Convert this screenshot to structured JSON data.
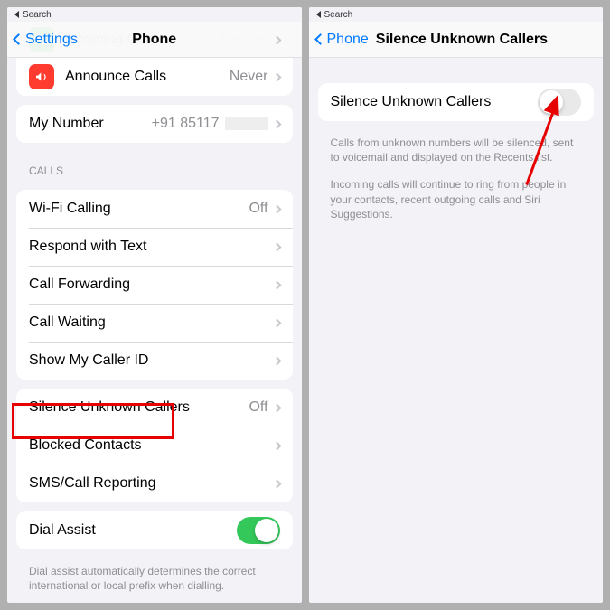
{
  "status": {
    "search_label": "Search"
  },
  "left": {
    "back_label": "Settings",
    "title": "Phone",
    "partial_rows": {
      "incoming_label": "incoming Calls",
      "incoming_value": "Banner"
    },
    "announce": {
      "label": "Announce Calls",
      "value": "Never"
    },
    "my_number": {
      "label": "My Number",
      "value": "+91 85117"
    },
    "calls_header": "CALLS",
    "wifi": {
      "label": "Wi-Fi Calling",
      "value": "Off"
    },
    "respond": {
      "label": "Respond with Text"
    },
    "forward": {
      "label": "Call Forwarding"
    },
    "waiting": {
      "label": "Call Waiting"
    },
    "callerid": {
      "label": "Show My Caller ID"
    },
    "silence": {
      "label": "Silence Unknown Callers",
      "value": "Off"
    },
    "blocked": {
      "label": "Blocked Contacts"
    },
    "sms": {
      "label": "SMS/Call Reporting"
    },
    "dial": {
      "label": "Dial Assist"
    },
    "dial_footer": "Dial assist automatically determines the correct international or local prefix when dialling."
  },
  "right": {
    "back_label": "Phone",
    "title": "Silence Unknown Callers",
    "toggle_label": "Silence Unknown Callers",
    "toggle_on": false,
    "desc1": "Calls from unknown numbers will be silenced, sent to voicemail and displayed on the Recents list.",
    "desc2": "Incoming calls will continue to ring from people in your contacts, recent outgoing calls and Siri Suggestions."
  }
}
